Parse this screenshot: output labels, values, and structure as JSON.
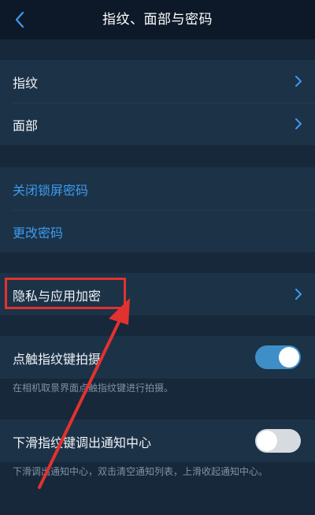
{
  "header": {
    "title": "指纹、面部与密码"
  },
  "biometrics": {
    "items": [
      {
        "label": "指纹"
      },
      {
        "label": "面部"
      }
    ]
  },
  "password": {
    "items": [
      {
        "label": "关闭锁屏密码"
      },
      {
        "label": "更改密码"
      }
    ]
  },
  "privacy": {
    "label": "隐私与应用加密"
  },
  "touch_capture": {
    "label": "点触指纹键拍摄",
    "enabled": true,
    "description": "在相机取景界面点触指纹键进行拍摄。"
  },
  "swipe_notification": {
    "label": "下滑指纹键调出通知中心",
    "enabled": false,
    "description": "下滑调出通知中心，双击清空通知列表，上滑收起通知中心。"
  },
  "colors": {
    "accent_blue": "#3d9bf0",
    "toggle_on": "#3e8fc8",
    "annotation_red": "#e2322f"
  }
}
